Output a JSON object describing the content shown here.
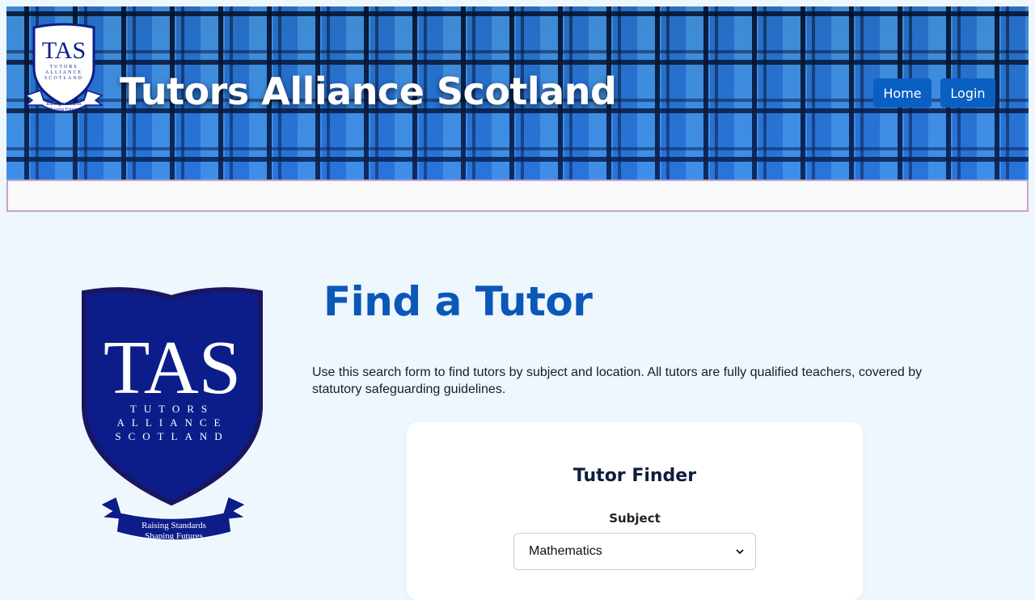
{
  "header": {
    "title": "Tutors Alliance Scotland",
    "nav": {
      "home_label": "Home",
      "login_label": "Login"
    }
  },
  "logo": {
    "monogram": "TAS",
    "name_line1": "TUTORS",
    "name_line2": "ALLIANCE",
    "name_line3": "SCOTLAND",
    "motto_line1": "Raising Standards",
    "motto_line2": "Shaping Futures"
  },
  "main": {
    "heading": "Find a Tutor",
    "intro": "Use this search form to find tutors by subject and location. All tutors are fully qualified teachers, covered by statutory safeguarding guidelines."
  },
  "finder": {
    "title": "Tutor Finder",
    "subject_label": "Subject",
    "subject_value": "Mathematics"
  },
  "colors": {
    "accent": "#0a5fc2",
    "heading": "#0b58b8",
    "page_bg": "#eef6fe",
    "shield": "#0c1d8a"
  }
}
